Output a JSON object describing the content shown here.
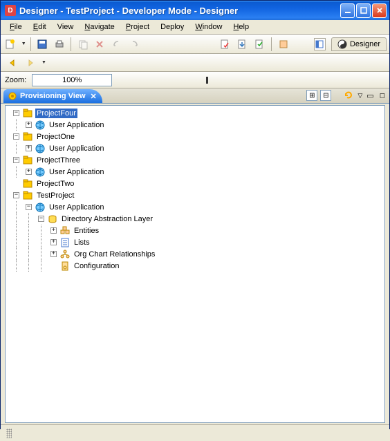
{
  "window": {
    "title": "Designer - TestProject - Developer Mode - Designer"
  },
  "menus": {
    "file": "File",
    "edit": "Edit",
    "view": "View",
    "navigate": "Navigate",
    "project": "Project",
    "deploy": "Deploy",
    "window": "Window",
    "help": "Help"
  },
  "toolbar": {
    "designer_tab": "Designer"
  },
  "zoom": {
    "label": "Zoom:",
    "value": "100%"
  },
  "view": {
    "title": "Provisioning View"
  },
  "tree": {
    "nodes": [
      {
        "depth": 0,
        "exp": "-",
        "icon": "project",
        "label": "ProjectFour",
        "selected": true
      },
      {
        "depth": 1,
        "exp": "+",
        "icon": "userapp",
        "label": "User Application"
      },
      {
        "depth": 0,
        "exp": "-",
        "icon": "project",
        "label": "ProjectOne"
      },
      {
        "depth": 1,
        "exp": "+",
        "icon": "userapp",
        "label": "User Application"
      },
      {
        "depth": 0,
        "exp": "-",
        "icon": "project",
        "label": "ProjectThree"
      },
      {
        "depth": 1,
        "exp": "+",
        "icon": "userapp",
        "label": "User Application"
      },
      {
        "depth": 0,
        "exp": "",
        "icon": "project",
        "label": "ProjectTwo"
      },
      {
        "depth": 0,
        "exp": "-",
        "icon": "project",
        "label": "TestProject"
      },
      {
        "depth": 1,
        "exp": "-",
        "icon": "userapp",
        "label": "User Application"
      },
      {
        "depth": 2,
        "exp": "-",
        "icon": "dal",
        "label": "Directory Abstraction Layer"
      },
      {
        "depth": 3,
        "exp": "+",
        "icon": "entities",
        "label": "Entities"
      },
      {
        "depth": 3,
        "exp": "+",
        "icon": "lists",
        "label": "Lists"
      },
      {
        "depth": 3,
        "exp": "+",
        "icon": "org",
        "label": "Org Chart Relationships"
      },
      {
        "depth": 3,
        "exp": "",
        "icon": "config",
        "label": "Configuration"
      }
    ]
  }
}
